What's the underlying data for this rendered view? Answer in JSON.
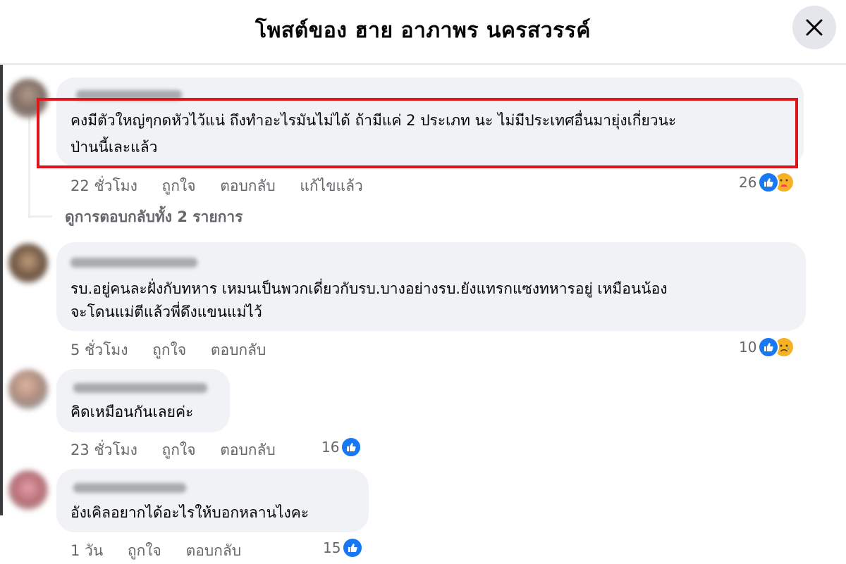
{
  "header": {
    "title": "โพสต์ของ ฮาย อาภาพร นครสวรรค์"
  },
  "colors": {
    "accent": "#1877f2",
    "highlight": "#e1141b",
    "bubble": "#f0f2f5",
    "meta": "#65676b"
  },
  "comments": [
    {
      "lines": [
        "คงมีตัวใหญ่ๆกดหัวไว้แน่ ถึงทำอะไรมันไม่ได้ ถ้ามีแค่ 2 ประเภท นะ ไม่มีประเทศอื่นมายุ่งเกี่ยวนะ",
        "ป่านนี้เละแล้ว"
      ],
      "time": "22 ชั่วโมง",
      "like": "ถูกใจ",
      "reply": "ตอบกลับ",
      "edited": "แก้ไขแล้ว",
      "reaction_count": "26",
      "reaction_icons": [
        "like-icon",
        "care-icon"
      ]
    },
    {
      "lines": [
        "รบ.อยู่คนละฝั่งกับทหาร เหมนเป็นพวกเดี่ยวกับรบ.บางอย่างรบ.ยังแทรกแซงทหารอยู่ เหมือนน้อง",
        "จะโดนแม่ตีแล้วพี่ดึงแขนแม่ไว้"
      ],
      "time": "5 ชั่วโมง",
      "like": "ถูกใจ",
      "reply": "ตอบกลับ",
      "reaction_count": "10",
      "reaction_icons": [
        "like-icon",
        "sad-icon"
      ]
    },
    {
      "lines": [
        "คิดเหมือนกันเลยค่ะ"
      ],
      "time": "23 ชั่วโมง",
      "like": "ถูกใจ",
      "reply": "ตอบกลับ",
      "reaction_count": "16",
      "reaction_icons": [
        "like-icon"
      ]
    },
    {
      "lines": [
        "อังเคิลอยากได้อะไรให้บอกหลานไงคะ"
      ],
      "time": "1 วัน",
      "like": "ถูกใจ",
      "reply": "ตอบกลับ",
      "reaction_count": "15",
      "reaction_icons": [
        "like-icon"
      ]
    }
  ],
  "view_replies": "ดูการตอบกลับทั้ง 2 รายการ"
}
